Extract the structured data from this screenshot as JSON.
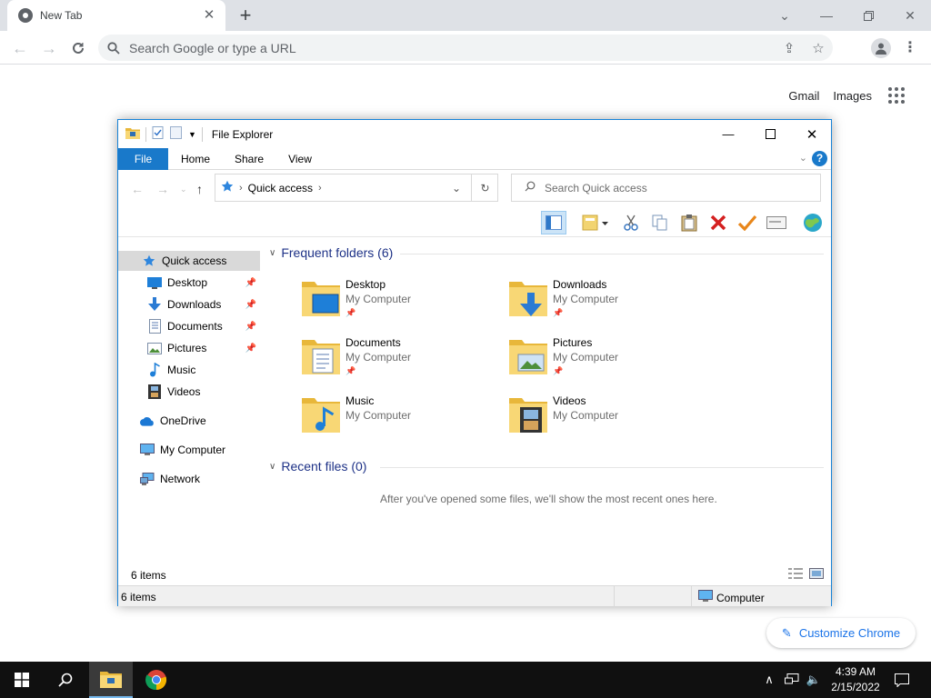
{
  "browser": {
    "tab_title": "New Tab",
    "omnibox_placeholder": "Search Google or type a URL",
    "links": [
      "Gmail",
      "Images"
    ],
    "customize_label": "Customize Chrome",
    "accent": "#1a73e8"
  },
  "explorer": {
    "title": "File Explorer",
    "ribbon_tabs": [
      "File",
      "Home",
      "Share",
      "View"
    ],
    "breadcrumb": "Quick access",
    "search_placeholder": "Search Quick access",
    "nav": {
      "quick_access": "Quick access",
      "items": [
        "Desktop",
        "Downloads",
        "Documents",
        "Pictures",
        "Music",
        "Videos"
      ],
      "onedrive": "OneDrive",
      "my_computer": "My Computer",
      "network": "Network"
    },
    "frequent_header": "Frequent folders (6)",
    "folders": [
      {
        "name": "Desktop",
        "location": "My Computer",
        "pinned": true
      },
      {
        "name": "Downloads",
        "location": "My Computer",
        "pinned": true
      },
      {
        "name": "Documents",
        "location": "My Computer",
        "pinned": true
      },
      {
        "name": "Pictures",
        "location": "My Computer",
        "pinned": true
      },
      {
        "name": "Music",
        "location": "My Computer",
        "pinned": false
      },
      {
        "name": "Videos",
        "location": "My Computer",
        "pinned": false
      }
    ],
    "recent_header": "Recent files (0)",
    "recent_empty": "After you've opened some files, we'll show the most recent ones here.",
    "status_items": "6 items",
    "bottom_items": "6 items",
    "bottom_location": "Computer",
    "accent": "#1979ca"
  },
  "taskbar": {
    "time": "4:39 AM",
    "date": "2/15/2022"
  }
}
